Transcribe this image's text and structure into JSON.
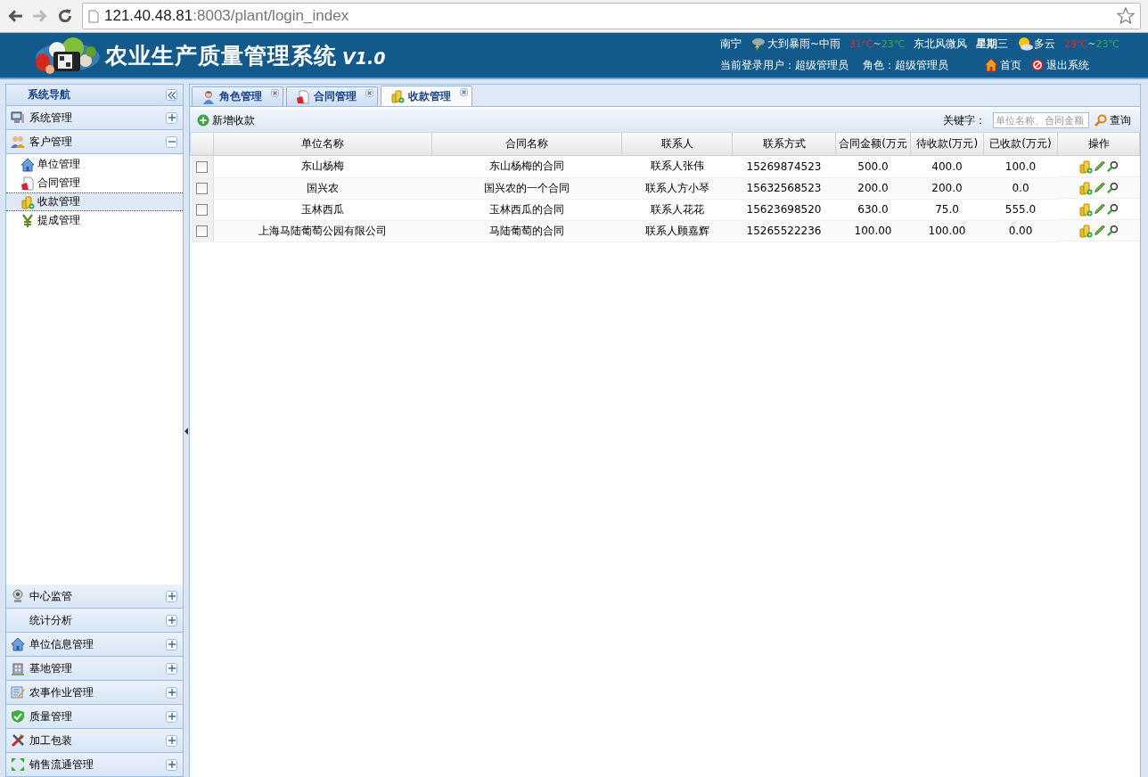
{
  "browser": {
    "url_host": "121.40.48.81",
    "url_path": ":8003/plant/login_index"
  },
  "header": {
    "title": "农业生产质量管理系统",
    "version": "V1.0",
    "weather": {
      "city": "南宁",
      "today": "大到暴雨~中雨",
      "today_temp": {
        "high": "31℃",
        "sep": "~",
        "low": "23℃"
      },
      "wind": "东北风微风",
      "weekday": "**星期**三",
      "tomorrow": "多云",
      "tomorrow_temp": {
        "high": "29℃",
        "sep": "~",
        "low": "23℃"
      }
    },
    "user": "当前登录用户：超级管理员",
    "role": "角色：超级管理员",
    "links": [
      "首页",
      "退出系统"
    ]
  },
  "sidebar": {
    "title": "系统导航",
    "sections": [
      {
        "label": "系统管理",
        "expanded": false
      },
      {
        "label": "客户管理",
        "expanded": true,
        "items": [
          {
            "label": "单位管理",
            "selected": false
          },
          {
            "label": "合同管理",
            "selected": false
          },
          {
            "label": "收款管理",
            "selected": true
          },
          {
            "label": "提成管理",
            "selected": false
          }
        ]
      },
      {
        "label": "中心监管",
        "expanded": false
      },
      {
        "label": "统计分析",
        "expanded": false
      },
      {
        "label": "单位信息管理",
        "expanded": false
      },
      {
        "label": "基地管理",
        "expanded": false
      },
      {
        "label": "农事作业管理",
        "expanded": false
      },
      {
        "label": "质量管理",
        "expanded": false
      },
      {
        "label": "加工包装",
        "expanded": false
      },
      {
        "label": "销售流通管理",
        "expanded": false
      }
    ]
  },
  "tabs": [
    {
      "label": "角色管理",
      "selected": false
    },
    {
      "label": "合同管理",
      "selected": false
    },
    {
      "label": "收款管理",
      "selected": true
    }
  ],
  "toolbar": {
    "add": "新增收款",
    "keyword_label": "关键字：",
    "search_placeholder": "单位名称、合同金额",
    "search": "查询"
  },
  "table": {
    "columns": [
      "单位名称",
      "合同名称",
      "联系人",
      "联系方式",
      "合同金额(万元",
      "待收款(万元)",
      "已收款(万元)",
      "操作"
    ],
    "rows": [
      {
        "checked": false,
        "cells": [
          "东山杨梅",
          "东山杨梅的合同",
          "联系人张伟",
          "15269874523",
          "500.0",
          "400.0",
          "100.0"
        ]
      },
      {
        "checked": false,
        "cells": [
          "国兴农",
          "国兴农的一个合同",
          "联系人方小琴",
          "15632568523",
          "200.0",
          "200.0",
          "0.0"
        ]
      },
      {
        "checked": false,
        "cells": [
          "玉林西瓜",
          "玉林西瓜的合同",
          "联系人花花",
          "15623698520",
          "630.0",
          "75.0",
          "555.0"
        ]
      },
      {
        "checked": false,
        "cells": [
          "上海马陆葡萄公园有限公司",
          "马陆葡萄的合同",
          "联系人顾嘉辉",
          "15265522236",
          "100.00",
          "100.00",
          "0.00"
        ]
      }
    ]
  }
}
